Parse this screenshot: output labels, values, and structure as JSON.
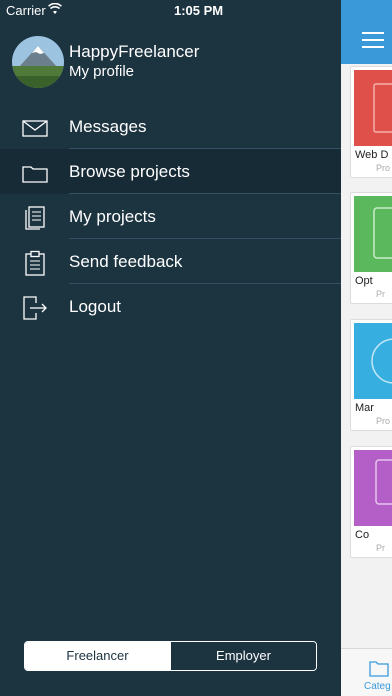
{
  "status_bar": {
    "carrier": "Carrier",
    "time": "1:05 PM"
  },
  "profile": {
    "name": "HappyFreelancer",
    "subtitle": "My profile"
  },
  "menu": [
    {
      "label": "Messages",
      "icon": "envelope-icon"
    },
    {
      "label": "Browse projects",
      "icon": "folder-icon",
      "active": true
    },
    {
      "label": "My projects",
      "icon": "documents-icon"
    },
    {
      "label": "Send feedback",
      "icon": "clipboard-icon"
    },
    {
      "label": "Logout",
      "icon": "logout-icon"
    }
  ],
  "mode_switch": {
    "options": [
      "Freelancer",
      "Employer"
    ],
    "selected": "Freelancer"
  },
  "main": {
    "cards": [
      {
        "title": "Web D",
        "sub": "Pro",
        "color": "#e0504a"
      },
      {
        "title": "Opt",
        "sub": "Pr",
        "color": "#5cb85c"
      },
      {
        "title": "Mar",
        "sub": "Pro",
        "color": "#37aee0"
      },
      {
        "title": "Co",
        "sub": "Pr",
        "color": "#b45fc8"
      }
    ],
    "tab_label": "Categ"
  },
  "colors": {
    "drawer_bg": "#1c3340",
    "accent": "#3a9ad9"
  }
}
